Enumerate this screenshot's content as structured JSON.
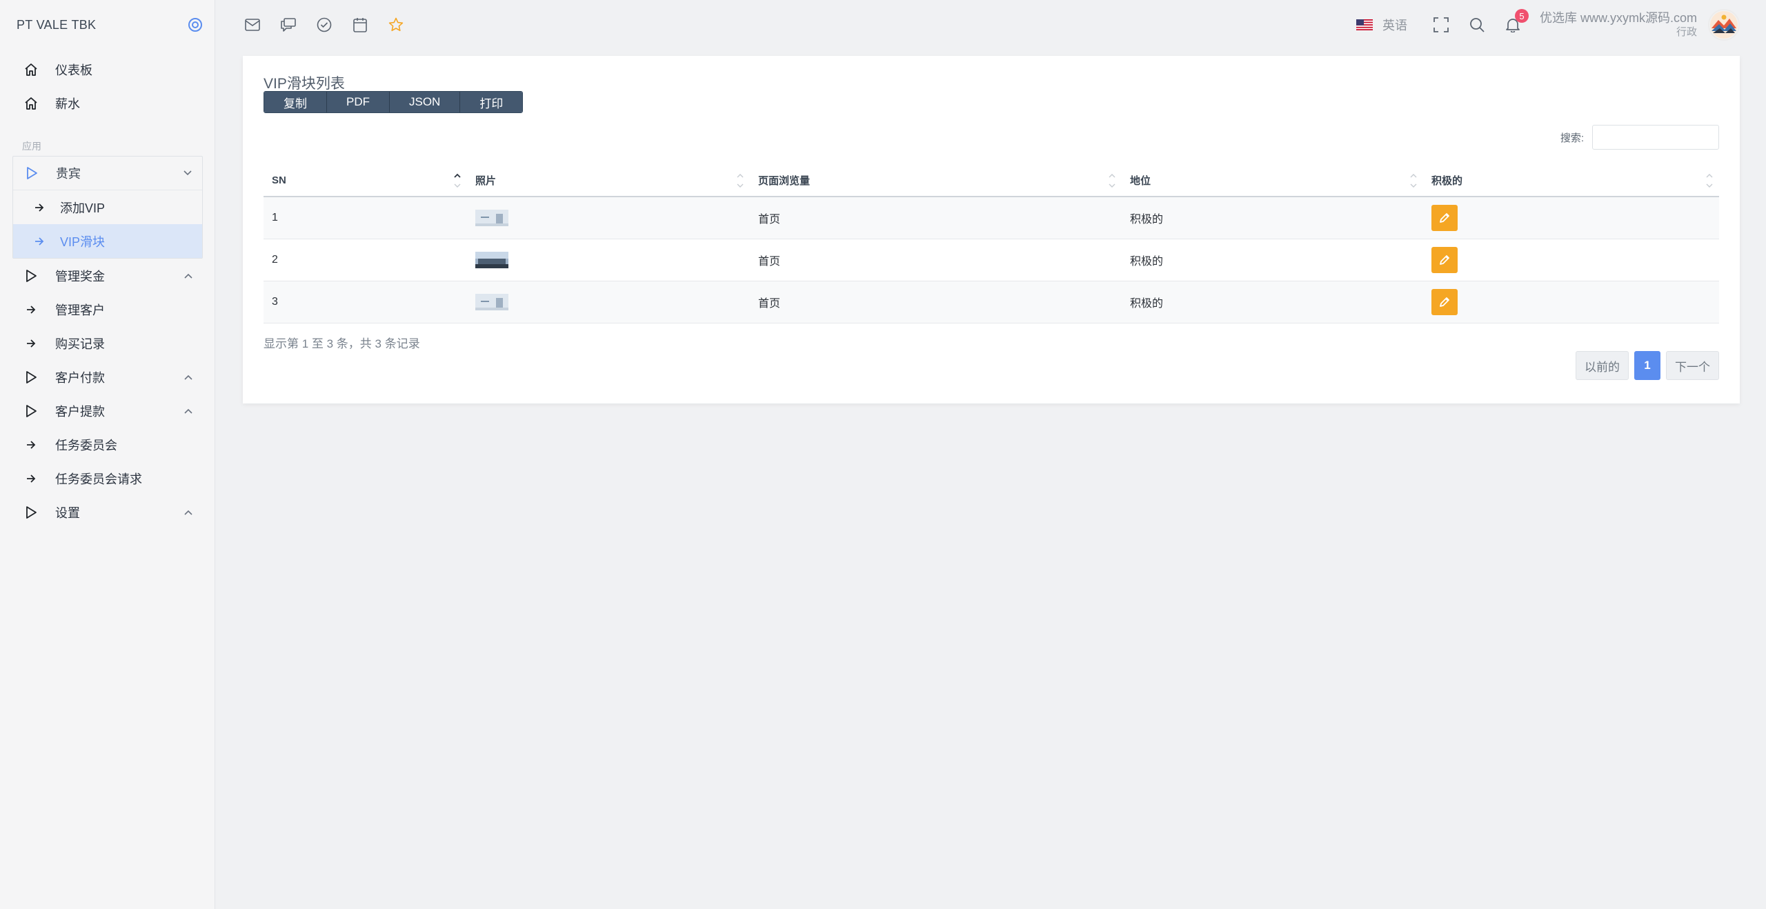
{
  "brand": {
    "name": "PT VALE TBK"
  },
  "sidebar": {
    "top_items": [
      {
        "label": "仪表板",
        "icon": "home-icon"
      },
      {
        "label": "薪水",
        "icon": "home-icon"
      }
    ],
    "section_label": "应用",
    "vip_group": {
      "label": "贵宾",
      "children": [
        {
          "label": "添加VIP",
          "active": false
        },
        {
          "label": "VIP滑块",
          "active": true
        }
      ]
    },
    "items": [
      {
        "label": "管理奖金",
        "type": "group"
      },
      {
        "label": "管理客户",
        "type": "link"
      },
      {
        "label": "购买记录",
        "type": "link"
      },
      {
        "label": "客户付款",
        "type": "group"
      },
      {
        "label": "客户提款",
        "type": "group"
      },
      {
        "label": "任务委员会",
        "type": "link"
      },
      {
        "label": "任务委员会请求",
        "type": "link"
      },
      {
        "label": "设置",
        "type": "group"
      }
    ]
  },
  "topbar": {
    "icons": [
      "mail-icon",
      "chat-icon",
      "check-circle-icon",
      "calendar-icon",
      "star-icon"
    ],
    "language": "英语",
    "notification_count": "5",
    "user_name": "优选库 www.yxymk源码.com",
    "user_role": "行政"
  },
  "card": {
    "title": "VIP滑块列表",
    "export_buttons": [
      "复制",
      "PDF",
      "JSON",
      "打印"
    ],
    "search_label": "搜索:",
    "search_value": ""
  },
  "table": {
    "columns": [
      "SN",
      "照片",
      "页面浏览量",
      "地位",
      "积极的"
    ],
    "rows": [
      {
        "sn": "1",
        "photo": "slider-thumbnail",
        "page": "首页",
        "status": "积极的"
      },
      {
        "sn": "2",
        "photo": "slider-thumbnail",
        "page": "首页",
        "status": "积极的"
      },
      {
        "sn": "3",
        "photo": "slider-thumbnail",
        "page": "首页",
        "status": "积极的"
      }
    ]
  },
  "footer": {
    "info": "显示第 1 至 3 条，共 3 条记录",
    "prev": "以前的",
    "page": "1",
    "next": "下一个"
  },
  "colors": {
    "accent": "#5b8def",
    "export_bg": "#44586f",
    "edit_btn": "#f5a623",
    "badge": "#f0506e",
    "active_bg": "#dbe6f8"
  }
}
